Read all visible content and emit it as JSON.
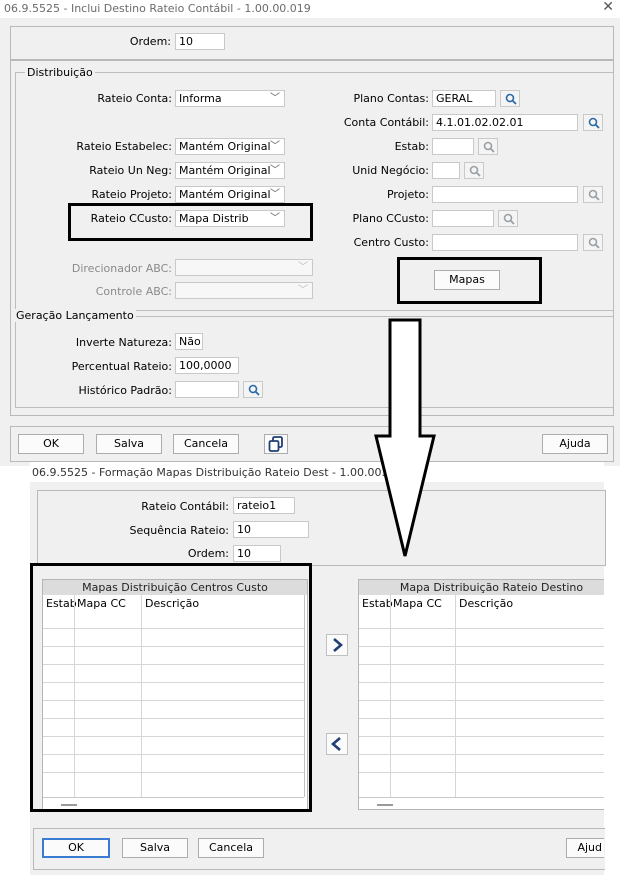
{
  "window1": {
    "title": "06.9.5525 - Inclui Destino Rateio Contábil - 1.00.00.019",
    "ordem": {
      "label": "Ordem:",
      "value": "10"
    },
    "distribuicao": {
      "group_label": "Distribuição",
      "rateio_conta": {
        "label": "Rateio Conta:",
        "value": "Informa"
      },
      "rateio_estabelec": {
        "label": "Rateio Estabelec:",
        "value": "Mantém Original"
      },
      "rateio_un_neg": {
        "label": "Rateio Un Neg:",
        "value": "Mantém Original"
      },
      "rateio_projeto": {
        "label": "Rateio Projeto:",
        "value": "Mantém Original"
      },
      "rateio_ccusto": {
        "label": "Rateio CCusto:",
        "value": "Mapa Distrib"
      },
      "direcionador_abc": {
        "label": "Direcionador ABC:",
        "value": ""
      },
      "controle_abc": {
        "label": "Controle ABC:",
        "value": ""
      },
      "plano_contas": {
        "label": "Plano Contas:",
        "value": "GERAL"
      },
      "conta_contabil": {
        "label": "Conta Contábil:",
        "value": "4.1.01.02.02.01"
      },
      "estab": {
        "label": "Estab:",
        "value": ""
      },
      "unid_negocio": {
        "label": "Unid Negócio:",
        "value": ""
      },
      "projeto": {
        "label": "Projeto:",
        "value": ""
      },
      "plano_ccusto": {
        "label": "Plano CCusto:",
        "value": ""
      },
      "centro_custo": {
        "label": "Centro Custo:",
        "value": ""
      },
      "mapas_button": "Mapas"
    },
    "geracao": {
      "group_label": "Geração Lançamento",
      "inverte_natureza": {
        "label": "Inverte Natureza:",
        "value": "Não"
      },
      "percentual_rateio": {
        "label": "Percentual Rateio:",
        "value": "100,0000"
      },
      "historico_padrao": {
        "label": "Histórico Padrão:",
        "value": ""
      }
    },
    "buttons": {
      "ok": "OK",
      "salva": "Salva",
      "cancela": "Cancela",
      "ajuda": "Ajuda"
    }
  },
  "window2": {
    "title": "06.9.5525 - Formação Mapas Distribuição Rateio Dest - 1.00.00.004",
    "rateio_contabil": {
      "label": "Rateio Contábil:",
      "value": "rateio1"
    },
    "sequencia_rateio": {
      "label": "Sequência Rateio:",
      "value": "10"
    },
    "ordem": {
      "label": "Ordem:",
      "value": "10"
    },
    "left_grid": {
      "title": "Mapas Distribuição Centros Custo",
      "columns": [
        "Estab",
        "Mapa CC",
        "Descrição"
      ]
    },
    "right_grid": {
      "title": "Mapa Distribuição Rateio Destino",
      "columns": [
        "Estab",
        "Mapa CC",
        "Descrição"
      ]
    },
    "buttons": {
      "ok": "OK",
      "salva": "Salva",
      "cancela": "Cancela",
      "ajuda": "Ajud"
    }
  },
  "icons": [
    "search-icon",
    "close-icon",
    "chevron-down-icon",
    "copy-icon",
    "arrow-right-icon",
    "arrow-left-icon",
    "down-arrow-annotation-icon"
  ]
}
